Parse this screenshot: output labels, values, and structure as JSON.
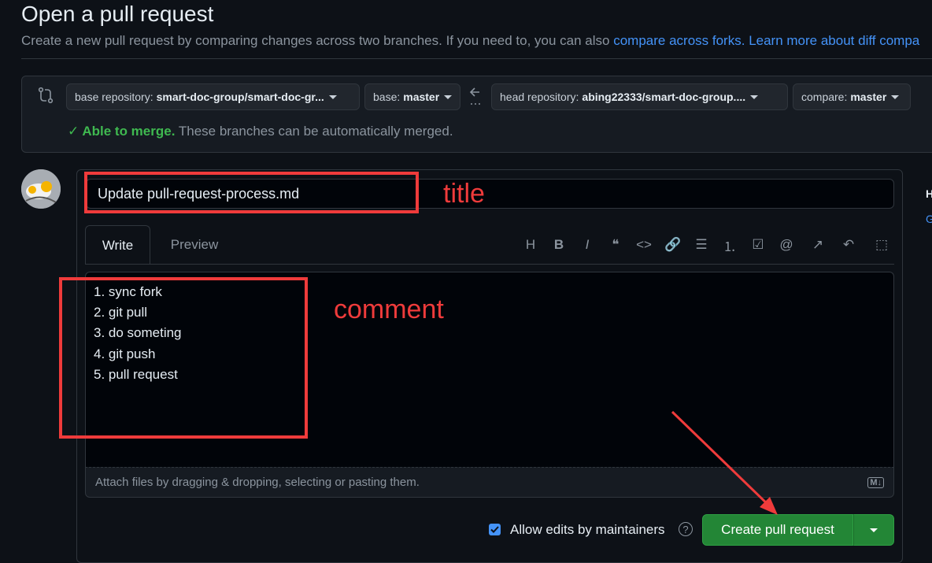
{
  "header": {
    "title": "Open a pull request",
    "subtitle_text": "Create a new pull request by comparing changes across two branches. If you need to, you can also ",
    "link_forks": "compare across forks.",
    "link_learn": "Learn more about diff compa"
  },
  "compare": {
    "base_repo_label": "base repository:",
    "base_repo_value": "smart-doc-group/smart-doc-gr...",
    "base_label": "base:",
    "base_value": "master",
    "head_repo_label": "head repository:",
    "head_repo_value": "abing22333/smart-doc-group....",
    "compare_label": "compare:",
    "compare_value": "master",
    "merge_ok": "Able to merge.",
    "merge_msg": " These branches can be automatically merged."
  },
  "form": {
    "title_value": "Update pull-request-process.md",
    "tab_write": "Write",
    "tab_preview": "Preview",
    "comment_value": "1. sync fork\n2. git pull\n3. do someting\n4. git push\n5. pull request",
    "attach_text": "Attach files by dragging & dropping, selecting or pasting them.",
    "allow_edits_label": "Allow edits by maintainers",
    "allow_edits_checked": true,
    "create_button": "Create pull request"
  },
  "toolbar": {
    "icons": [
      "heading-icon",
      "bold-icon",
      "italic-icon",
      "quote-icon",
      "code-icon",
      "link-icon",
      "unordered-list-icon",
      "ordered-list-icon",
      "task-list-icon",
      "mention-icon",
      "cross-reference-icon",
      "reply-icon",
      "fullscreen-icon"
    ],
    "glyphs": [
      "H",
      "B",
      "I",
      "❝",
      "<>",
      "🔗",
      "☰",
      "⒈",
      "☑",
      "@",
      "↗",
      "↶",
      "⬚"
    ]
  },
  "side_cut": {
    "t1": "H",
    "t2": "G"
  },
  "annotations": {
    "title_label": "title",
    "comment_label": "comment",
    "color": "#ef3b3b"
  },
  "colors": {
    "background": "#0d1117",
    "accent_link": "#4493f8",
    "success": "#3fb950",
    "primary_button": "#238636"
  }
}
